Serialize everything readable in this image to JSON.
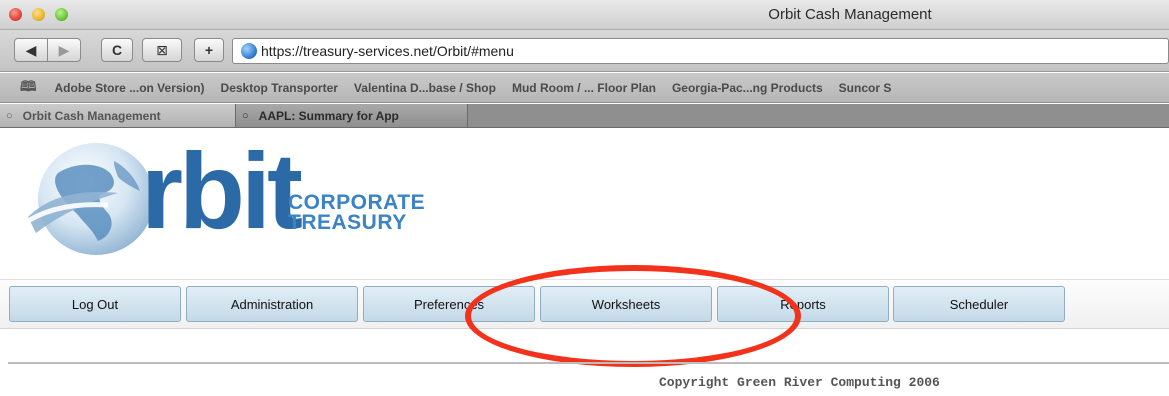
{
  "window": {
    "title": "Orbit Cash Management"
  },
  "toolbar": {
    "back_glyph": "◀",
    "forward_glyph": "▶",
    "reload_glyph": "C",
    "stop_glyph": "⊠",
    "add_glyph": "+",
    "url": "https://treasury-services.net/Orbit/#menu"
  },
  "bookmarks": {
    "items": [
      "Adobe Store ...on Version)",
      "Desktop Transporter",
      "Valentina D...base / Shop",
      "Mud Room / ... Floor Plan",
      "Georgia-Pac...ng Products",
      "Suncor S"
    ]
  },
  "tabs": [
    {
      "label": "Orbit Cash Management"
    },
    {
      "label": "AAPL: Summary for App"
    }
  ],
  "logo": {
    "word": "rbit",
    "line1": "CORPORATE",
    "line2": "TREASURY"
  },
  "nav": [
    {
      "label": "Log Out"
    },
    {
      "label": "Administration"
    },
    {
      "label": "Preferences"
    },
    {
      "label": "Worksheets"
    },
    {
      "label": "Reports"
    },
    {
      "label": "Scheduler"
    }
  ],
  "footer": {
    "copyright": "Copyright Green River Computing 2006"
  },
  "colors": {
    "brand_blue": "#2b6aa6",
    "nav_button": "#c3d9e8",
    "highlight": "#f2321a"
  }
}
